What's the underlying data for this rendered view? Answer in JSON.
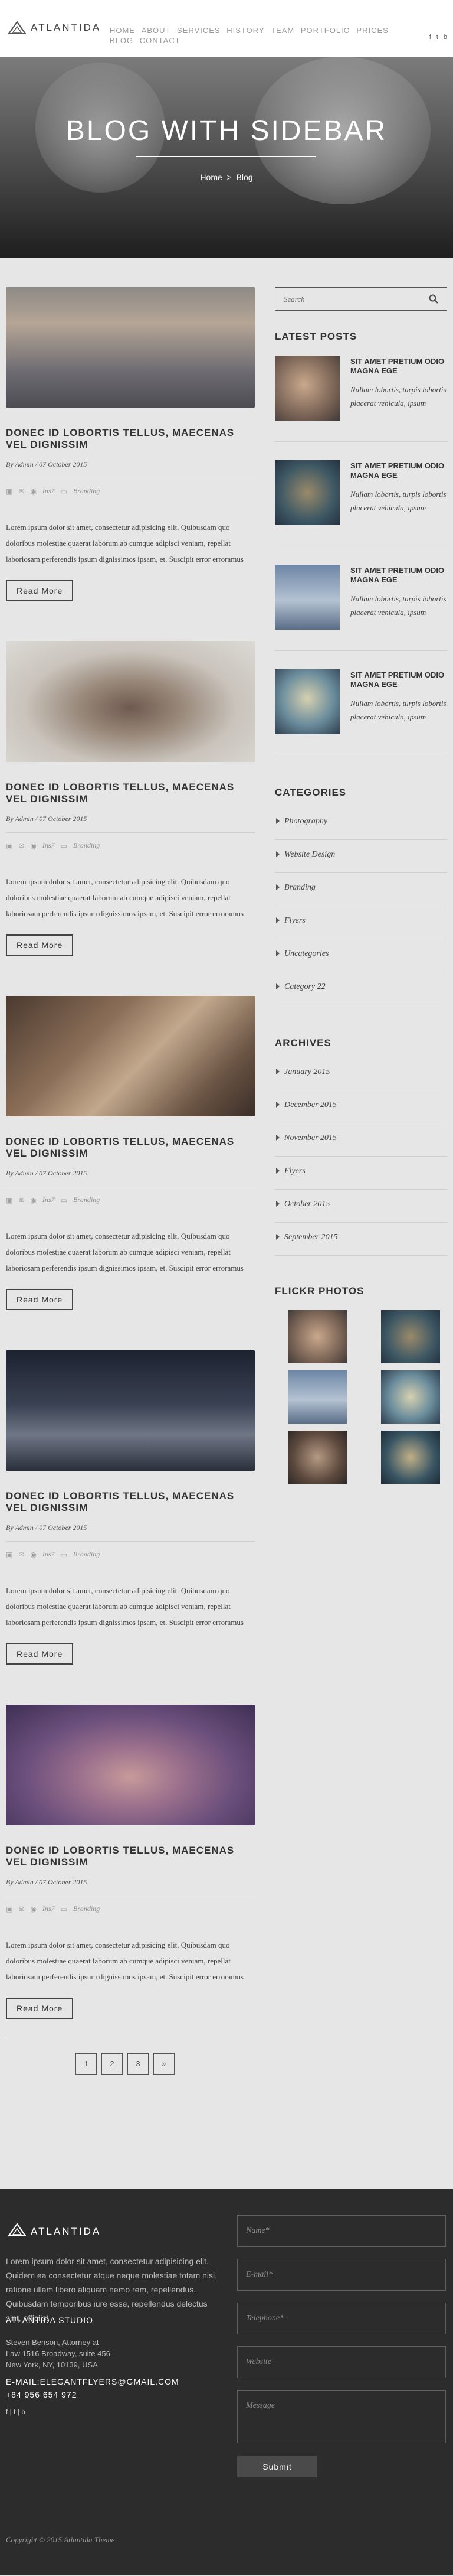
{
  "brand": {
    "name": "ATLANTIDA"
  },
  "nav": [
    "HOME",
    "ABOUT",
    "SERVICES",
    "HISTORY",
    "TEAM",
    "PORTFOLIO",
    "PRICES",
    "BLOG",
    "CONTACT"
  ],
  "social_top": "f | t | b",
  "hero": {
    "title": "BLOG WITH SIDEBAR",
    "crumb_home": "Home",
    "crumb_sep": ">",
    "crumb_current": "Blog"
  },
  "posts": [
    {
      "title": "DONEC ID LOBORTIS TELLUS, MAECENAS VEL DIGNISSIM",
      "meta": "By Admin / 07 October 2015",
      "stats": "Ins7",
      "tag": "Branding",
      "excerpt": "Lorem ipsum dolor sit amet, consectetur adipisicing elit. Quibusdam quo doloribus molestiae quaerat laborum ab cumque adipisci veniam, repellat laboriosam perferendis ipsum dignissimos ipsam, et. Suscipit error erroramus",
      "button": "Read More"
    },
    {
      "title": "DONEC ID LOBORTIS TELLUS, MAECENAS VEL DIGNISSIM",
      "meta": "By Admin / 07 October 2015",
      "stats": "Ins7",
      "tag": "Branding",
      "excerpt": "Lorem ipsum dolor sit amet, consectetur adipisicing elit. Quibusdam quo doloribus molestiae quaerat laborum ab cumque adipisci veniam, repellat laboriosam perferendis ipsum dignissimos ipsam, et. Suscipit error erroramus",
      "button": "Read More"
    },
    {
      "title": "DONEC ID LOBORTIS TELLUS, MAECENAS VEL DIGNISSIM",
      "meta": "By Admin / 07 October 2015",
      "stats": "Ins7",
      "tag": "Branding",
      "excerpt": "Lorem ipsum dolor sit amet, consectetur adipisicing elit. Quibusdam quo doloribus molestiae quaerat laborum ab cumque adipisci veniam, repellat laboriosam perferendis ipsum dignissimos ipsam, et. Suscipit error erroramus",
      "button": "Read More"
    },
    {
      "title": "DONEC ID LOBORTIS TELLUS, MAECENAS VEL DIGNISSIM",
      "meta": "By Admin / 07 October 2015",
      "stats": "Ins7",
      "tag": "Branding",
      "excerpt": "Lorem ipsum dolor sit amet, consectetur adipisicing elit. Quibusdam quo doloribus molestiae quaerat laborum ab cumque adipisci veniam, repellat laboriosam perferendis ipsum dignissimos ipsam, et. Suscipit error erroramus",
      "button": "Read More"
    },
    {
      "title": "DONEC ID LOBORTIS TELLUS, MAECENAS VEL DIGNISSIM",
      "meta": "By Admin / 07 October 2015",
      "stats": "Ins7",
      "tag": "Branding",
      "excerpt": "Lorem ipsum dolor sit amet, consectetur adipisicing elit. Quibusdam quo doloribus molestiae quaerat laborum ab cumque adipisci veniam, repellat laboriosam perferendis ipsum dignissimos ipsam, et. Suscipit error erroramus",
      "button": "Read More"
    }
  ],
  "pagination": [
    "1",
    "2",
    "3",
    "»"
  ],
  "sidebar": {
    "search_placeholder": "Search",
    "latest_title": "LATEST POSTS",
    "latest": [
      {
        "title": "SIT AMET PRETIUM ODIO MAGNA EGE",
        "text": "Nullam lobortis, turpis lobortis placerat vehicula, ipsum"
      },
      {
        "title": "SIT AMET PRETIUM ODIO MAGNA EGE",
        "text": "Nullam lobortis, turpis lobortis placerat vehicula, ipsum"
      },
      {
        "title": "SIT AMET PRETIUM ODIO MAGNA EGE",
        "text": "Nullam lobortis, turpis lobortis placerat vehicula, ipsum"
      },
      {
        "title": "SIT AMET PRETIUM ODIO MAGNA EGE",
        "text": "Nullam lobortis, turpis lobortis placerat vehicula, ipsum"
      }
    ],
    "categories_title": "CATEGORIES",
    "categories": [
      "Photography",
      "Website Design",
      "Branding",
      "Flyers",
      "Uncategories",
      "Category 22"
    ],
    "archives_title": "ARCHIVES",
    "archives": [
      "January 2015",
      "December 2015",
      "November 2015",
      "Flyers",
      "October 2015",
      "September 2015"
    ],
    "flickr_title": "FLICKR PHOTOS"
  },
  "footer": {
    "brand": "ATLANTIDA",
    "about": "Lorem ipsum dolor sit amet, consectetur adipisicing elit. Quidem ea consectetur atque neque molestiae totam nisi, ratione ullam libero aliquam nemo rem, repellendus. Quibusdam temporibus iure esse, repellendus delectus sint, officiis!",
    "studio": "ATLANTIDA STUDIO",
    "address": [
      "Steven Benson, Attorney at",
      "Law 1516 Broadway, suite 456",
      "New York, NY, 10139, USA"
    ],
    "email": "E-MAIL:ELEGANTFLYERS@GMAIL.COM",
    "phone": "+84 956 654 972",
    "social": "f | t | b",
    "fields": [
      "Name*",
      "E-mail*",
      "Telephone*",
      "Website",
      "Message"
    ],
    "submit": "Submit",
    "copyright": "Copyright © 2015 Atlantida Theme"
  }
}
